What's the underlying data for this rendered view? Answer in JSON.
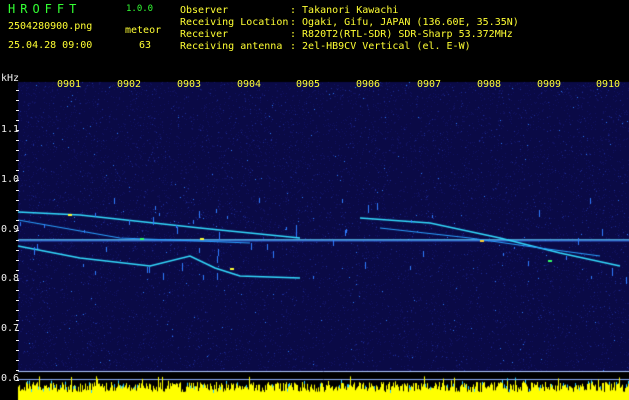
{
  "header": {
    "app_title": "HROFFT",
    "app_version": "1.0.0",
    "file_name": "2504280900.png",
    "timestamp": "25.04.28 09:00",
    "meteor_label": "meteor",
    "meteor_count": "63",
    "info": [
      {
        "label": "Observer",
        "value": ": Takanori Kawachi"
      },
      {
        "label": "Receiving Location",
        "value": ": Ogaki, Gifu, JAPAN (136.60E, 35.35N)"
      },
      {
        "label": "Receiver",
        "value": ": R820T2(RTL-SDR) SDR-Sharp 53.372MHz"
      },
      {
        "label": "Receiving antenna",
        "value": ": 2el-HB9CV Vertical (el. E-W)"
      }
    ]
  },
  "spectrogram": {
    "unit_label": "kHz",
    "time_labels": [
      "0901",
      "0902",
      "0903",
      "0904",
      "0905",
      "0906",
      "0907",
      "0908",
      "0909",
      "0910"
    ],
    "freq_labels": [
      "1.1",
      "1.0",
      "0.9",
      "0.8",
      "0.7",
      "0.6"
    ],
    "colors": {
      "text": "#ffff33",
      "signal": "#33ddff",
      "power": "#ffff00",
      "background": "#0a0a46"
    }
  }
}
